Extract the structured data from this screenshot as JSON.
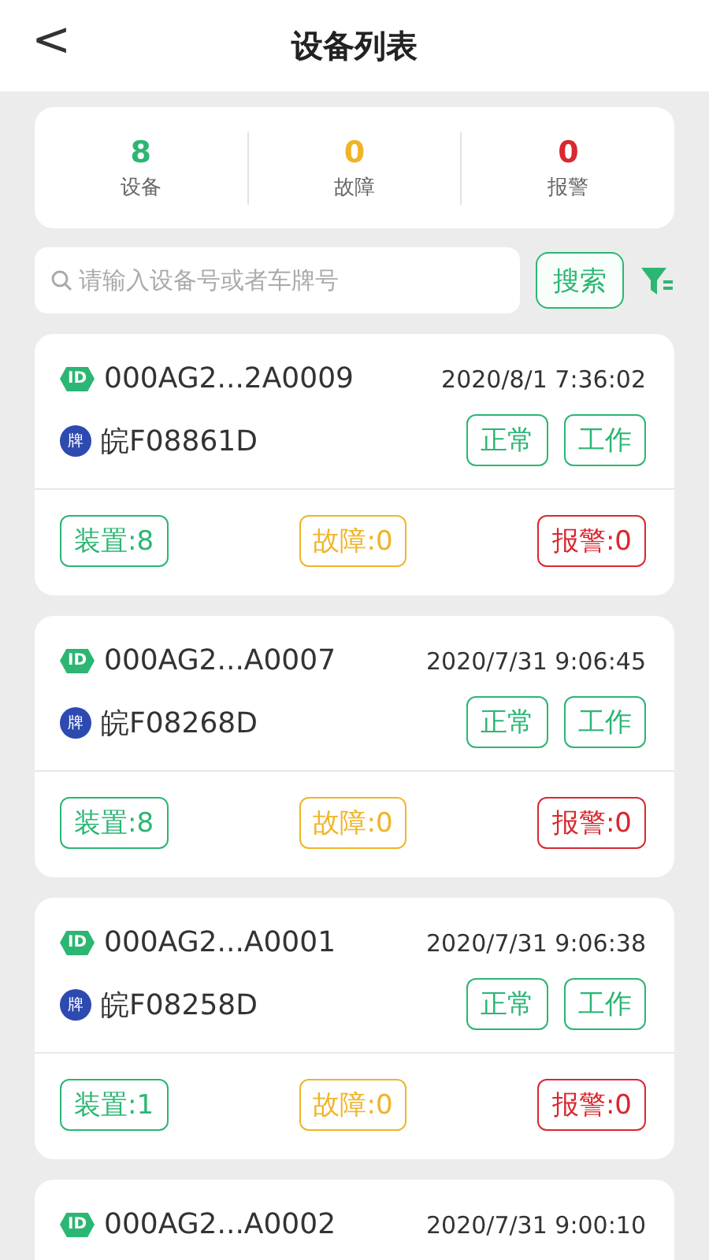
{
  "header": {
    "back": "<",
    "title": "设备列表"
  },
  "stats": [
    {
      "value": "8",
      "label": "设备",
      "color": "#2bb673"
    },
    {
      "value": "0",
      "label": "故障",
      "color": "#f0b429"
    },
    {
      "value": "0",
      "label": "报警",
      "color": "#d9282f"
    }
  ],
  "search": {
    "placeholder": "请输入设备号或者车牌号",
    "button": "搜索"
  },
  "devices": [
    {
      "id_badge": "ID",
      "id": "000AG2...2A0009",
      "time": "2020/8/1 7:36:02",
      "plate_badge": "牌",
      "plate": "皖F08861D",
      "tags": [
        {
          "label": "正常",
          "color": "#2bb673"
        },
        {
          "label": "工作",
          "color": "#2bb673"
        }
      ],
      "counts": [
        {
          "label": "装置:8",
          "color": "#2bb673"
        },
        {
          "label": "故障:0",
          "color": "#f0b429"
        },
        {
          "label": "报警:0",
          "color": "#d9282f"
        }
      ]
    },
    {
      "id_badge": "ID",
      "id": "000AG2...A0007",
      "time": "2020/7/31 9:06:45",
      "plate_badge": "牌",
      "plate": "皖F08268D",
      "tags": [
        {
          "label": "正常",
          "color": "#2bb673"
        },
        {
          "label": "工作",
          "color": "#2bb673"
        }
      ],
      "counts": [
        {
          "label": "装置:8",
          "color": "#2bb673"
        },
        {
          "label": "故障:0",
          "color": "#f0b429"
        },
        {
          "label": "报警:0",
          "color": "#d9282f"
        }
      ]
    },
    {
      "id_badge": "ID",
      "id": "000AG2...A0001",
      "time": "2020/7/31 9:06:38",
      "plate_badge": "牌",
      "plate": "皖F08258D",
      "tags": [
        {
          "label": "正常",
          "color": "#2bb673"
        },
        {
          "label": "工作",
          "color": "#2bb673"
        }
      ],
      "counts": [
        {
          "label": "装置:1",
          "color": "#2bb673"
        },
        {
          "label": "故障:0",
          "color": "#f0b429"
        },
        {
          "label": "报警:0",
          "color": "#d9282f"
        }
      ]
    },
    {
      "id_badge": "ID",
      "id": "000AG2...A0002",
      "time": "2020/7/31 9:00:10"
    }
  ]
}
